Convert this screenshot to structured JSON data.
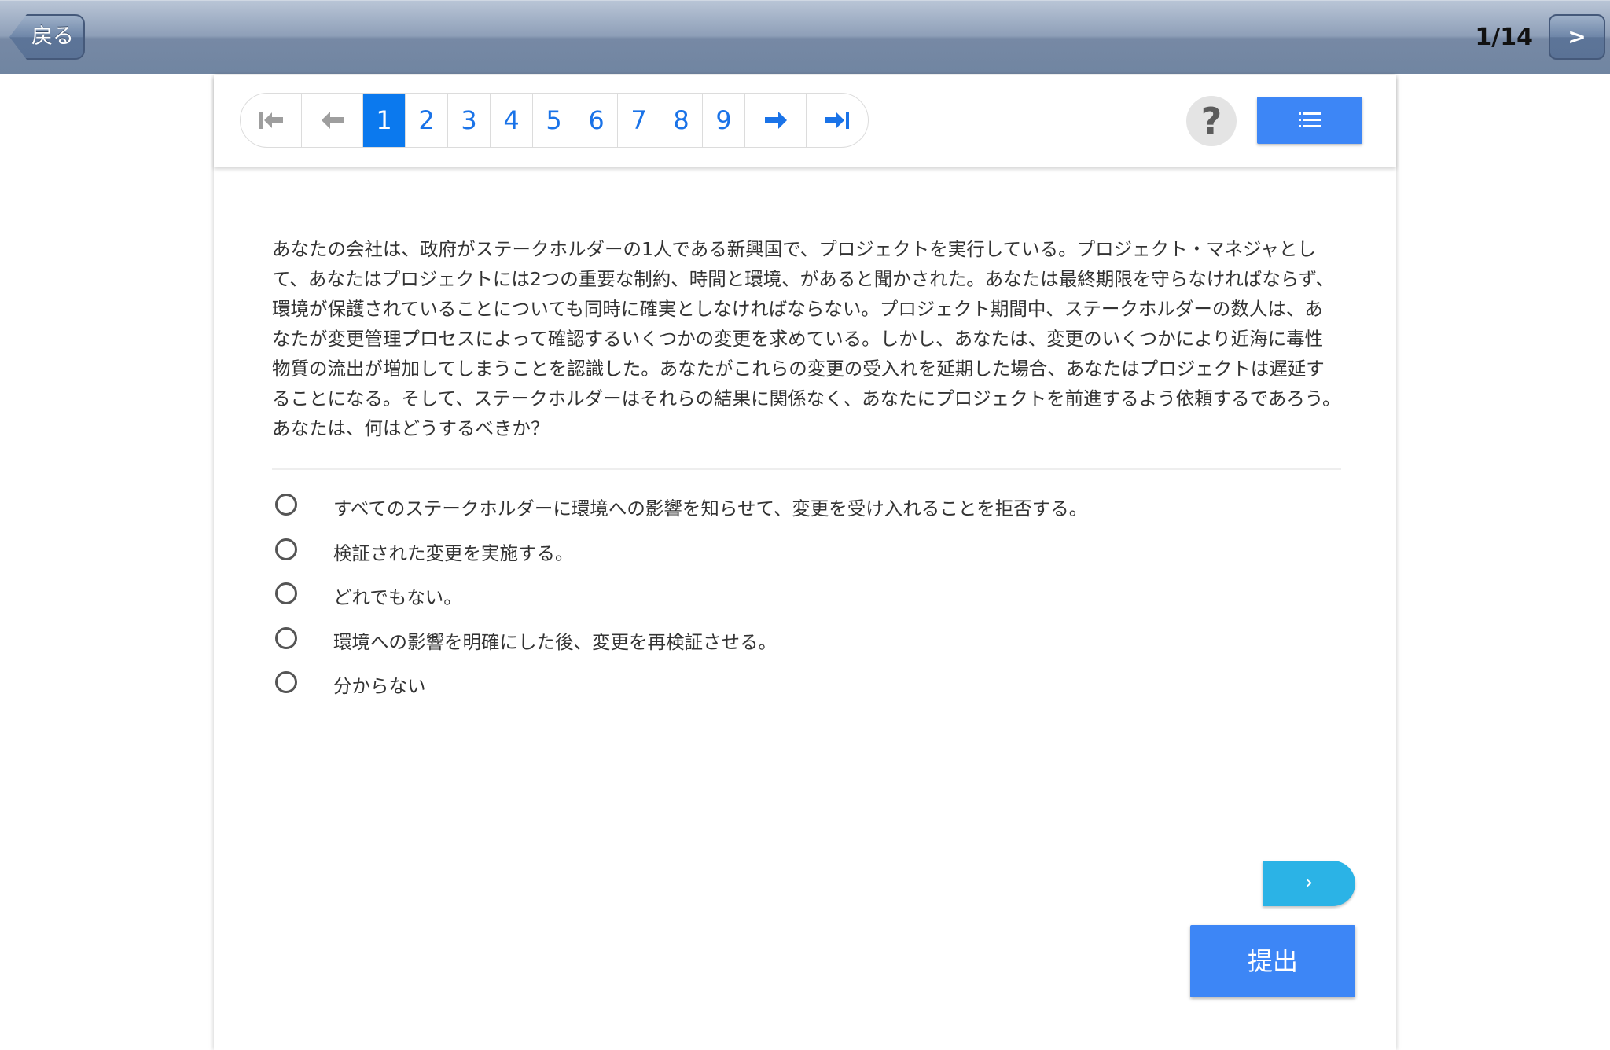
{
  "topbar": {
    "back_label": "戻る",
    "page_counter": "1/14",
    "next_label": ">"
  },
  "pager": {
    "first_icon": "first-page-icon",
    "prev_icon": "arrow-left-icon",
    "pages": [
      "1",
      "2",
      "3",
      "4",
      "5",
      "6",
      "7",
      "8",
      "9"
    ],
    "active_page": "1",
    "next_icon": "arrow-right-icon",
    "last_icon": "last-page-icon"
  },
  "toolbar": {
    "help_label": "?",
    "list_icon": "list-icon"
  },
  "question": {
    "text": "あなたの会社は、政府がステークホルダーの1人である新興国で、プロジェクトを実行している。プロジェクト・マネジャとして、あなたはプロジェクトには2つの重要な制約、時間と環境、があると聞かされた。あなたは最終期限を守らなければならず、環境が保護されていることについても同時に確実としなければならない。プロジェクト期間中、ステークホルダーの数人は、あなたが変更管理プロセスによって確認するいくつかの変更を求めている。しかし、あなたは、変更のいくつかにより近海に毒性物質の流出が増加してしまうことを認識した。あなたがこれらの変更の受入れを延期した場合、あなたはプロジェクトは遅延することになる。そして、ステークホルダーはそれらの結果に関係なく、あなたにプロジェクトを前進するよう依頼するであろう。あなたは、何はどうするべきか？"
  },
  "options": [
    "すべてのステークホルダーに環境への影響を知らせて、変更を受け入れることを拒否する。",
    "検証された変更を実施する。",
    "どれでもない。",
    "環境への影響を明確にした後、変更を再検証させる。",
    "分からない"
  ],
  "buttons": {
    "next_label": "›",
    "submit_label": "提出"
  },
  "colors": {
    "accent_blue": "#3d86f6",
    "active_page": "#0b79ee",
    "next_button": "#2bb3e6",
    "topbar": "#7085a1"
  }
}
